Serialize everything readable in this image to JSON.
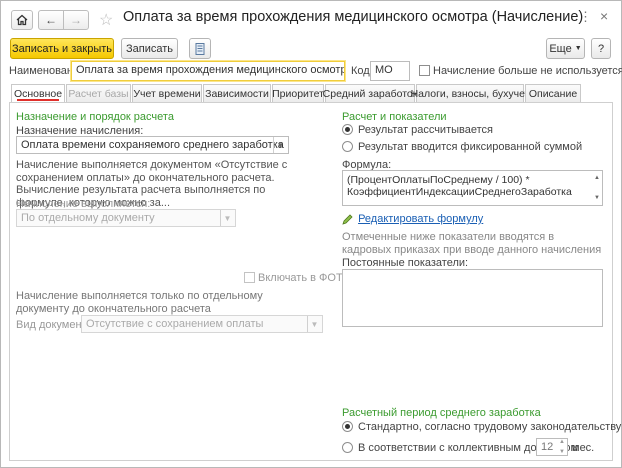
{
  "window": {
    "title": "Оплата за время прохождения медицинского осмотра (Начисление)",
    "icons": {
      "home": "home-icon",
      "back": "arrow-left-icon",
      "forward": "arrow-right-icon",
      "favorite": "star-icon",
      "menu": "more-icon",
      "close": "close-icon"
    }
  },
  "toolbar": {
    "save_close_label": "Записать и закрыть",
    "save_label": "Записать",
    "more_label": "Еще",
    "help_label": "?"
  },
  "header": {
    "name_label": "Наименование:",
    "name_value": "Оплата за время прохождения медицинского осмотра",
    "code_label": "Код:",
    "code_value": "МО",
    "unused_label": "Начисление больше не используется"
  },
  "tabs": [
    {
      "label": "Основное"
    },
    {
      "label": "Расчет базы"
    },
    {
      "label": "Учет времени"
    },
    {
      "label": "Зависимости"
    },
    {
      "label": "Приоритет"
    },
    {
      "label": "Средний заработок"
    },
    {
      "label": "Налоги, взносы, бухучет"
    },
    {
      "label": "Описание"
    }
  ],
  "left": {
    "section_title": "Назначение и порядок расчета",
    "purpose_label": "Назначение начисления:",
    "purpose_value": "Оплата времени сохраняемого среднего заработка",
    "description": "Начисление выполняется документом «Отсутствие с сохранением оплаты» до окончательного расчета. Вычисление результата расчета выполняется по формуле, которую можно за...",
    "executed_label": "Начисление выполняется:",
    "executed_value": "По отдельному документу",
    "fot_label": "Включать в ФОТ",
    "separate_doc_note": "Начисление выполняется только по отдельному документу до окончательного расчета",
    "doc_type_label": "Вид документа:",
    "doc_type_value": "Отсутствие с сохранением оплаты"
  },
  "right": {
    "section_title": "Расчет и показатели",
    "radio_calculated": "Результат рассчитывается",
    "radio_fixed": "Результат вводится фиксированной суммой",
    "formula_label": "Формула:",
    "formula_line1": "(ПроцентОплатыПоСреднему / 100) *",
    "formula_line2": "КоэффициентИндексацииСреднегоЗаработка",
    "edit_formula": "Редактировать формулу",
    "note": "Отмеченные ниже показатели вводятся в кадровых приказах при вводе данного начисления",
    "constant_label": "Постоянные показатели:",
    "period_title": "Расчетный период среднего заработка",
    "radio_standard": "Стандартно, согласно трудовому законодательству",
    "radio_collective": "В соответствии с коллективным договором",
    "months_value": "12",
    "months_unit": "мес."
  },
  "colors": {
    "accent_yellow": "#f5c800",
    "section_green": "#3b9b2f",
    "active_tab_red": "#e0302b",
    "link_blue": "#1a5fb4"
  }
}
